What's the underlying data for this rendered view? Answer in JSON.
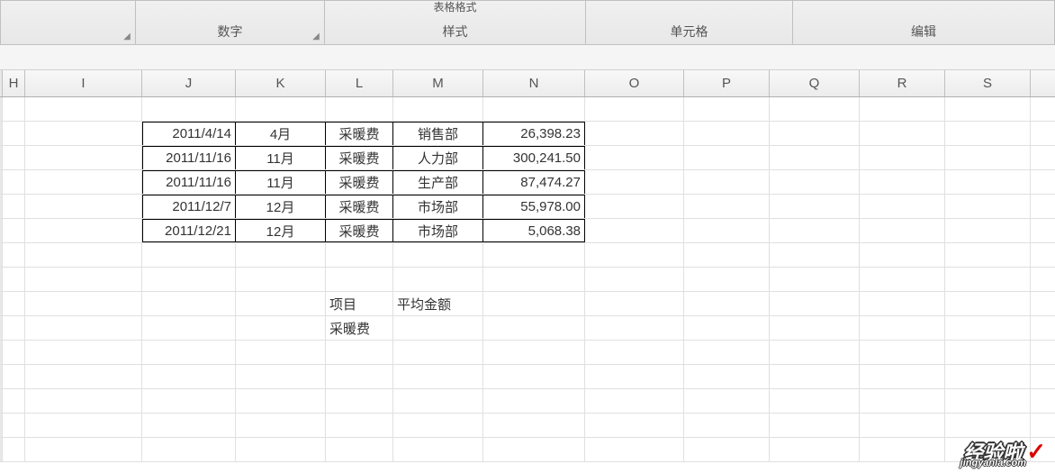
{
  "ribbon": {
    "topLabel": "表格格式",
    "group2": "数字",
    "group3": "样式",
    "group4": "单元格",
    "group5": "编辑"
  },
  "columns": {
    "H": "H",
    "I": "I",
    "J": "J",
    "K": "K",
    "L": "L",
    "M": "M",
    "N": "N",
    "O": "O",
    "P": "P",
    "Q": "Q",
    "R": "R",
    "S": "S"
  },
  "table": {
    "rows": [
      {
        "J": "2011/4/14",
        "K": "4月",
        "L": "采暖费",
        "M": "销售部",
        "N": "26,398.23"
      },
      {
        "J": "2011/11/16",
        "K": "11月",
        "L": "采暖费",
        "M": "人力部",
        "N": "300,241.50"
      },
      {
        "J": "2011/11/16",
        "K": "11月",
        "L": "采暖费",
        "M": "生产部",
        "N": "87,474.27"
      },
      {
        "J": "2011/12/7",
        "K": "12月",
        "L": "采暖费",
        "M": "市场部",
        "N": "55,978.00"
      },
      {
        "J": "2011/12/21",
        "K": "12月",
        "L": "采暖费",
        "M": "市场部",
        "N": "5,068.38"
      }
    ]
  },
  "summary": {
    "header1": "项目",
    "header2": "平均金额",
    "row1": "采暖费"
  },
  "watermark": {
    "main": "经验啦",
    "check": "✓",
    "url": "jingyanla.com"
  }
}
